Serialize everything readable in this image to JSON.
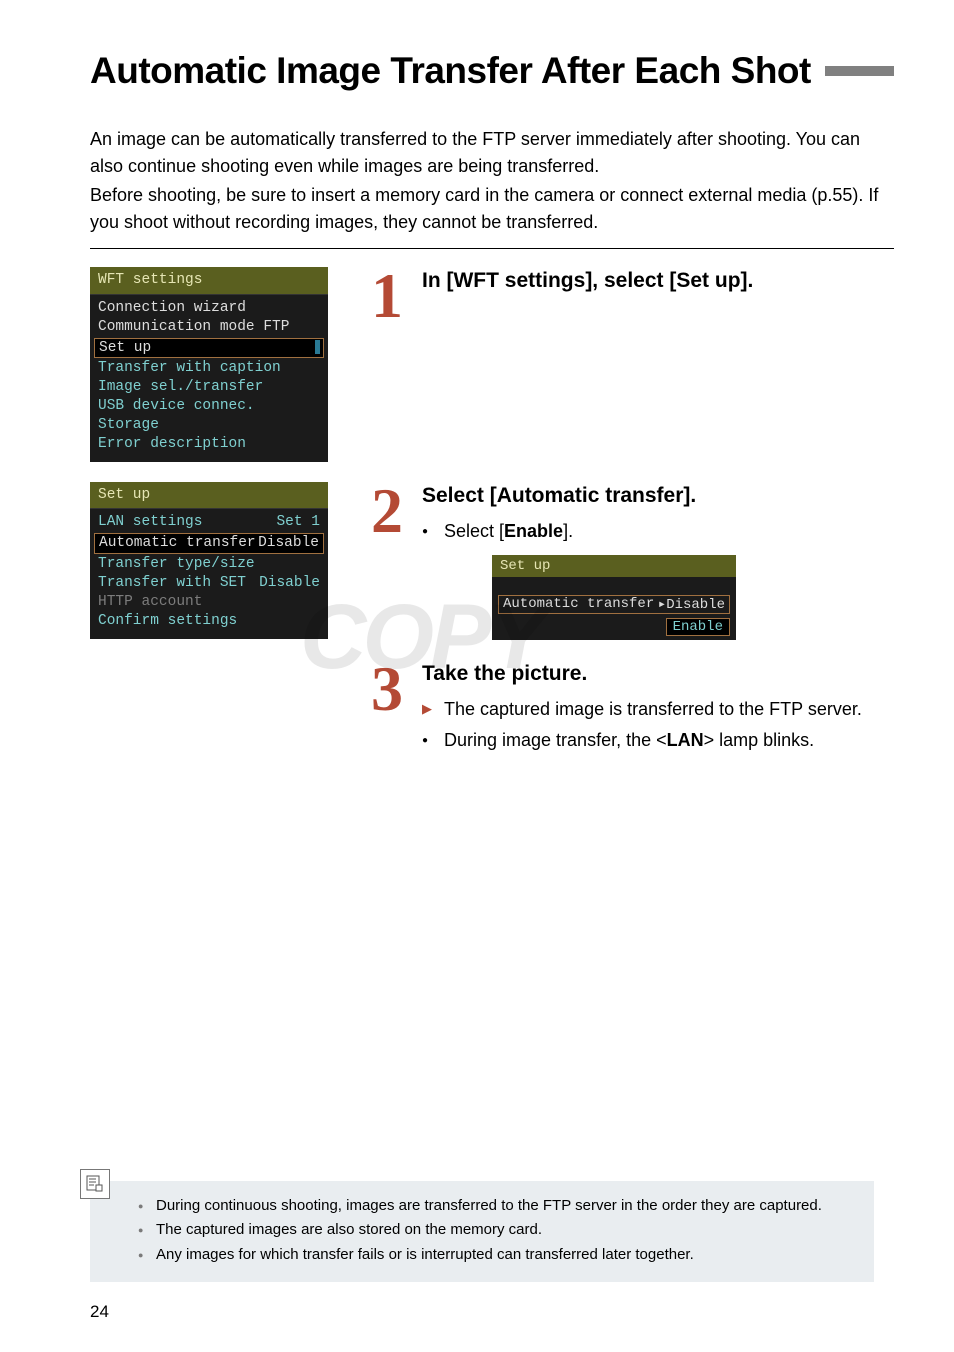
{
  "title": "Automatic Image Transfer After Each Shot",
  "intro": {
    "p1": "An image can be automatically transferred to the FTP server immediately after shooting. You can also continue shooting even while images are being transferred.",
    "p2": "Before shooting, be sure to insert a memory card in the camera or connect external media (p.55). If you shoot without recording images, they cannot be transferred."
  },
  "watermark": "COPY",
  "steps": {
    "s1": {
      "num": "1",
      "heading": "In [WFT settings], select [Set up].",
      "screen": {
        "header": "WFT settings",
        "items": {
          "i1": "Connection wizard",
          "i2": "Communication mode FTP",
          "i3": "Set up",
          "i4": "Transfer with caption",
          "i5": "Image sel./transfer",
          "i6": "USB device connec. Storage",
          "i7": "Error description"
        }
      }
    },
    "s2": {
      "num": "2",
      "heading": "Select [Automatic transfer].",
      "bullet_prefix": "Select [",
      "bullet_bold": "Enable",
      "bullet_suffix": "].",
      "screen": {
        "header": "Set up",
        "rows": {
          "r1l": "LAN settings",
          "r1r": "Set 1",
          "r2l": "Automatic transfer",
          "r2r": "Disable",
          "r3l": "Transfer type/size",
          "r3r": "",
          "r4l": "Transfer with SET",
          "r4r": "Disable",
          "r5l": "HTTP account",
          "r5r": "",
          "r6l": "Confirm settings",
          "r6r": ""
        }
      },
      "mini": {
        "header": "Set up",
        "label": "Automatic transfer",
        "val": "Disable",
        "sel": "Enable"
      }
    },
    "s3": {
      "num": "3",
      "heading": "Take the picture.",
      "arrow": "The captured image is transferred to the FTP server.",
      "dot_prefix": "During image transfer, the <",
      "dot_bold": "LAN",
      "dot_suffix": "> lamp blinks."
    }
  },
  "notes": {
    "n1": "During continuous shooting, images are transferred to the FTP server in the order they are captured.",
    "n2": "The captured images are also stored on the memory card.",
    "n3": "Any images for which transfer fails or is interrupted can transferred later together."
  },
  "pagenum": "24"
}
